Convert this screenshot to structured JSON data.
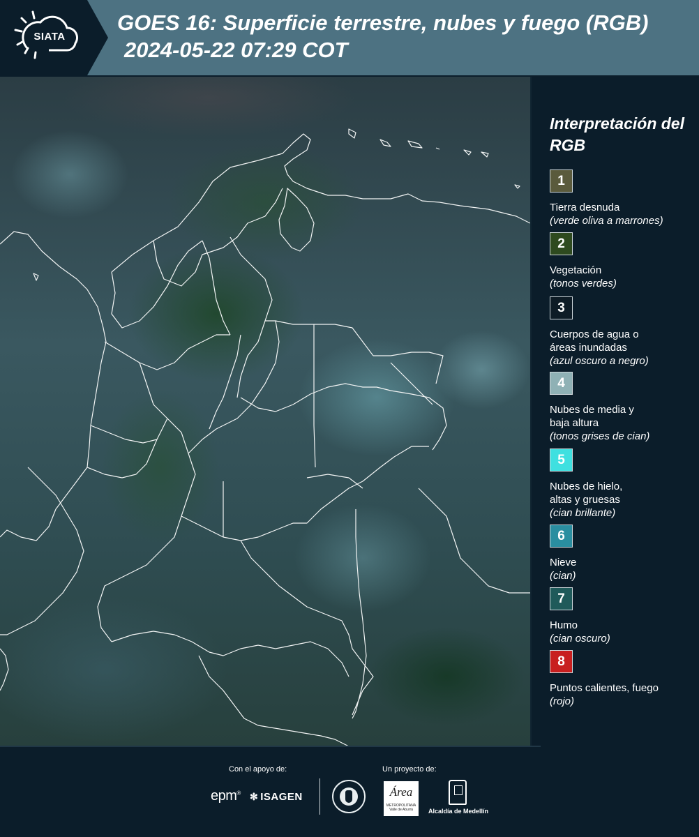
{
  "header": {
    "logo_text": "SIATA",
    "title": "GOES 16: Superficie terrestre, nubes y fuego (RGB)",
    "subtitle": "2024-05-22 07:29 COT"
  },
  "legend": {
    "title": "Interpretación del RGB",
    "items": [
      {
        "number": "1",
        "name": "Tierra desnuda",
        "desc": "(verde oliva a marrones)",
        "color": "#5a5a3c"
      },
      {
        "number": "2",
        "name": "Vegetación",
        "desc": "(tonos verdes)",
        "color": "#2e4a1f"
      },
      {
        "number": "3",
        "name": "Cuerpos de agua o áreas inundadas",
        "desc": "(azul oscuro a negro)",
        "color": "#0e1c26"
      },
      {
        "number": "4",
        "name": "Nubes de media y baja altura",
        "desc": "(tonos grises de cian)",
        "color": "#8fb1b5"
      },
      {
        "number": "5",
        "name": "Nubes de hielo, altas y gruesas",
        "desc": "(cian brillante)",
        "color": "#3fe0e0"
      },
      {
        "number": "6",
        "name": "Nieve",
        "desc": "(cian)",
        "color": "#2a8ea0"
      },
      {
        "number": "7",
        "name": "Humo",
        "desc": "(cian oscuro)",
        "color": "#1f5a5a"
      },
      {
        "number": "8",
        "name": "Puntos calientes, fuego",
        "desc": "(rojo)",
        "color": "#c81f1f"
      }
    ]
  },
  "footer": {
    "support_label": "Con el apoyo de:",
    "project_label": "Un proyecto de:",
    "epm": "epm",
    "isagen": "ISAGEN",
    "amva": "Área",
    "amva_sub": "METROPOLITANA Valle de Aburrá",
    "alcaldia": "Alcaldía de Medellín"
  }
}
